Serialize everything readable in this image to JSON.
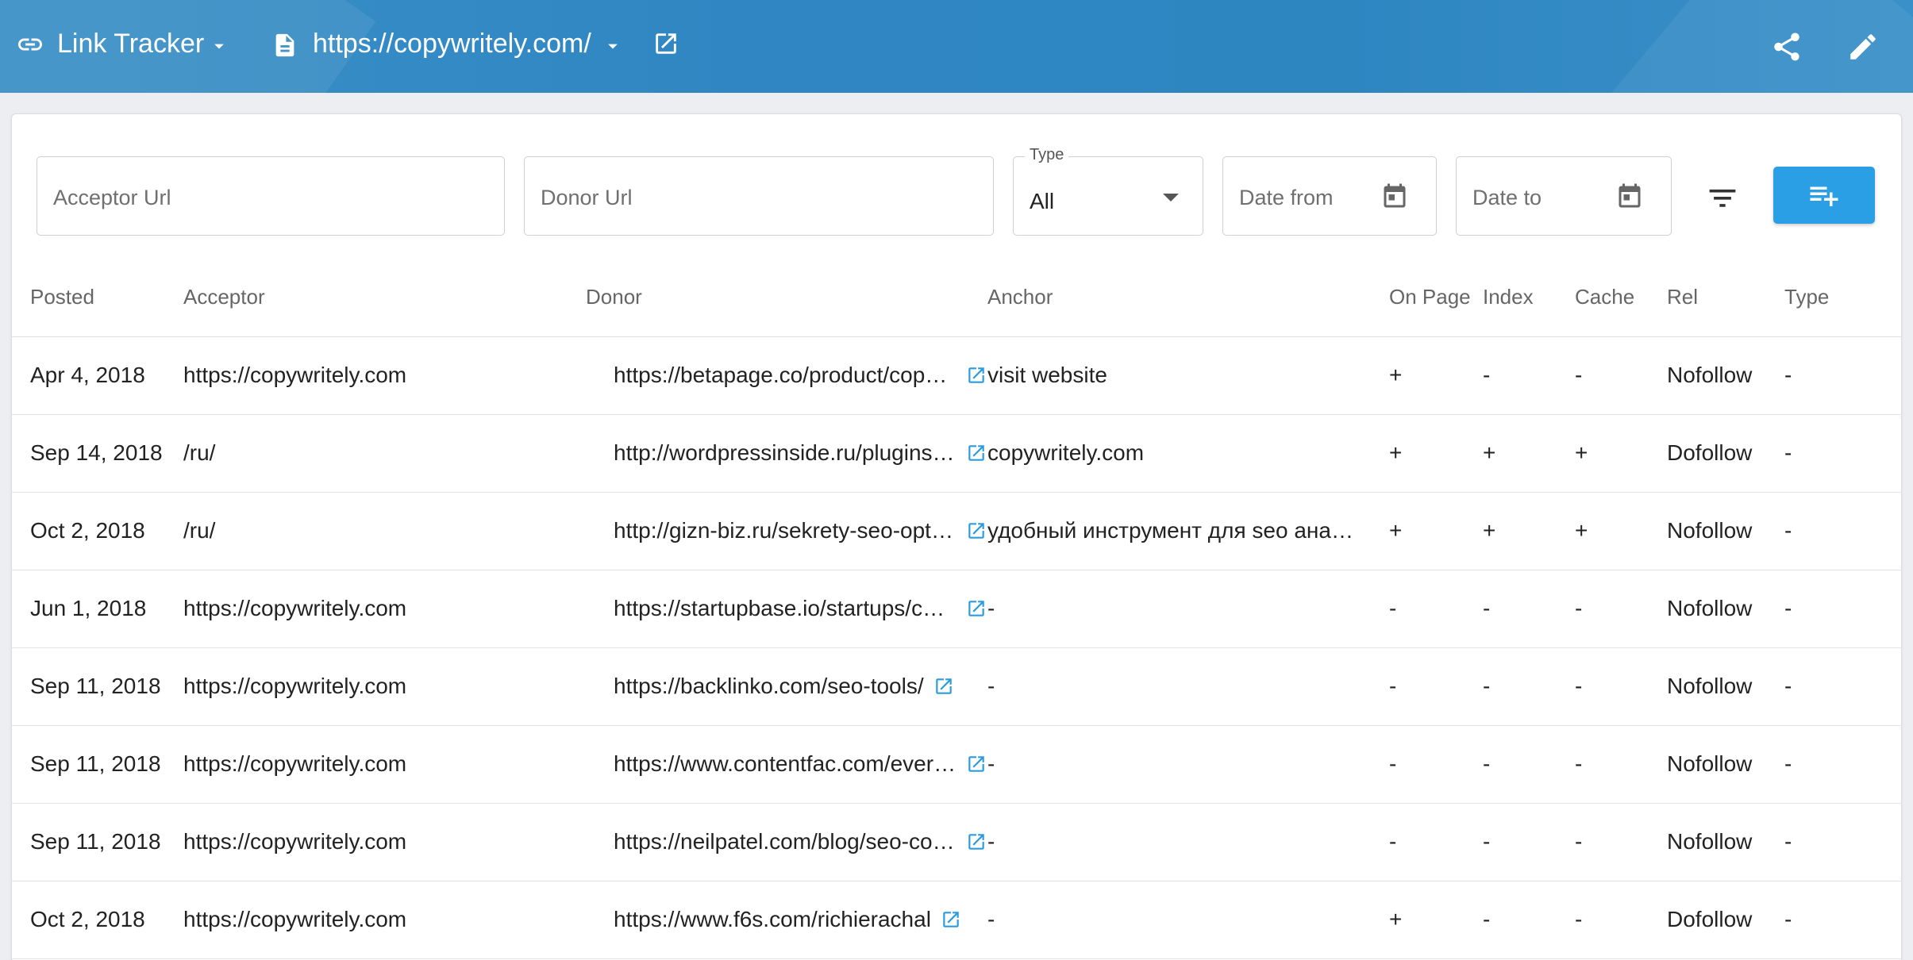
{
  "header": {
    "app_title": "Link Tracker",
    "site_url": "https://copywritely.com/",
    "icons": [
      "link-icon",
      "chevron-down-icon",
      "document-icon",
      "open-in-new-icon",
      "share-icon",
      "edit-icon"
    ]
  },
  "filters": {
    "acceptor_placeholder": "Acceptor Url",
    "donor_placeholder": "Donor Url",
    "type_label": "Type",
    "type_value": "All",
    "date_from_placeholder": "Date from",
    "date_to_placeholder": "Date to"
  },
  "table": {
    "columns": [
      "Posted",
      "Acceptor",
      "Donor",
      "Anchor",
      "On Page",
      "Index",
      "Cache",
      "Rel",
      "Type"
    ],
    "rows": [
      {
        "posted": "Apr 4, 2018",
        "acceptor": "https://copywritely.com",
        "donor": "https://betapage.co/product/copywritely",
        "anchor": "visit website",
        "on_page": "+",
        "index": "-",
        "cache": "-",
        "rel": "Nofollow",
        "type": "-"
      },
      {
        "posted": "Sep 14, 2018",
        "acceptor": "/ru/",
        "donor": "http://wordpressinside.ru/plugins/seo-plugins",
        "anchor": "copywritely.com",
        "on_page": "+",
        "index": "+",
        "cache": "+",
        "rel": "Dofollow",
        "type": "-"
      },
      {
        "posted": "Oct 2, 2018",
        "acceptor": "/ru/",
        "donor": "http://gizn-biz.ru/sekrety-seo-optimizacii",
        "anchor": "удобный инструмент для seo анализа",
        "on_page": "+",
        "index": "+",
        "cache": "+",
        "rel": "Nofollow",
        "type": "-"
      },
      {
        "posted": "Jun 1, 2018",
        "acceptor": "https://copywritely.com",
        "donor": "https://startupbase.io/startups/copywritely",
        "anchor": "-",
        "on_page": "-",
        "index": "-",
        "cache": "-",
        "rel": "Nofollow",
        "type": "-"
      },
      {
        "posted": "Sep 11, 2018",
        "acceptor": "https://copywritely.com",
        "donor": "https://backlinko.com/seo-tools/",
        "anchor": "-",
        "on_page": "-",
        "index": "-",
        "cache": "-",
        "rel": "Nofollow",
        "type": "-"
      },
      {
        "posted": "Sep 11, 2018",
        "acceptor": "https://copywritely.com",
        "donor": "https://www.contentfac.com/everything-seo",
        "anchor": "-",
        "on_page": "-",
        "index": "-",
        "cache": "-",
        "rel": "Nofollow",
        "type": "-"
      },
      {
        "posted": "Sep 11, 2018",
        "acceptor": "https://copywritely.com",
        "donor": "https://neilpatel.com/blog/seo-copywriting",
        "anchor": "-",
        "on_page": "-",
        "index": "-",
        "cache": "-",
        "rel": "Nofollow",
        "type": "-"
      },
      {
        "posted": "Oct 2, 2018",
        "acceptor": "https://copywritely.com",
        "donor": "https://www.f6s.com/richierachal",
        "anchor": "-",
        "on_page": "+",
        "index": "-",
        "cache": "-",
        "rel": "Dofollow",
        "type": "-"
      }
    ]
  }
}
